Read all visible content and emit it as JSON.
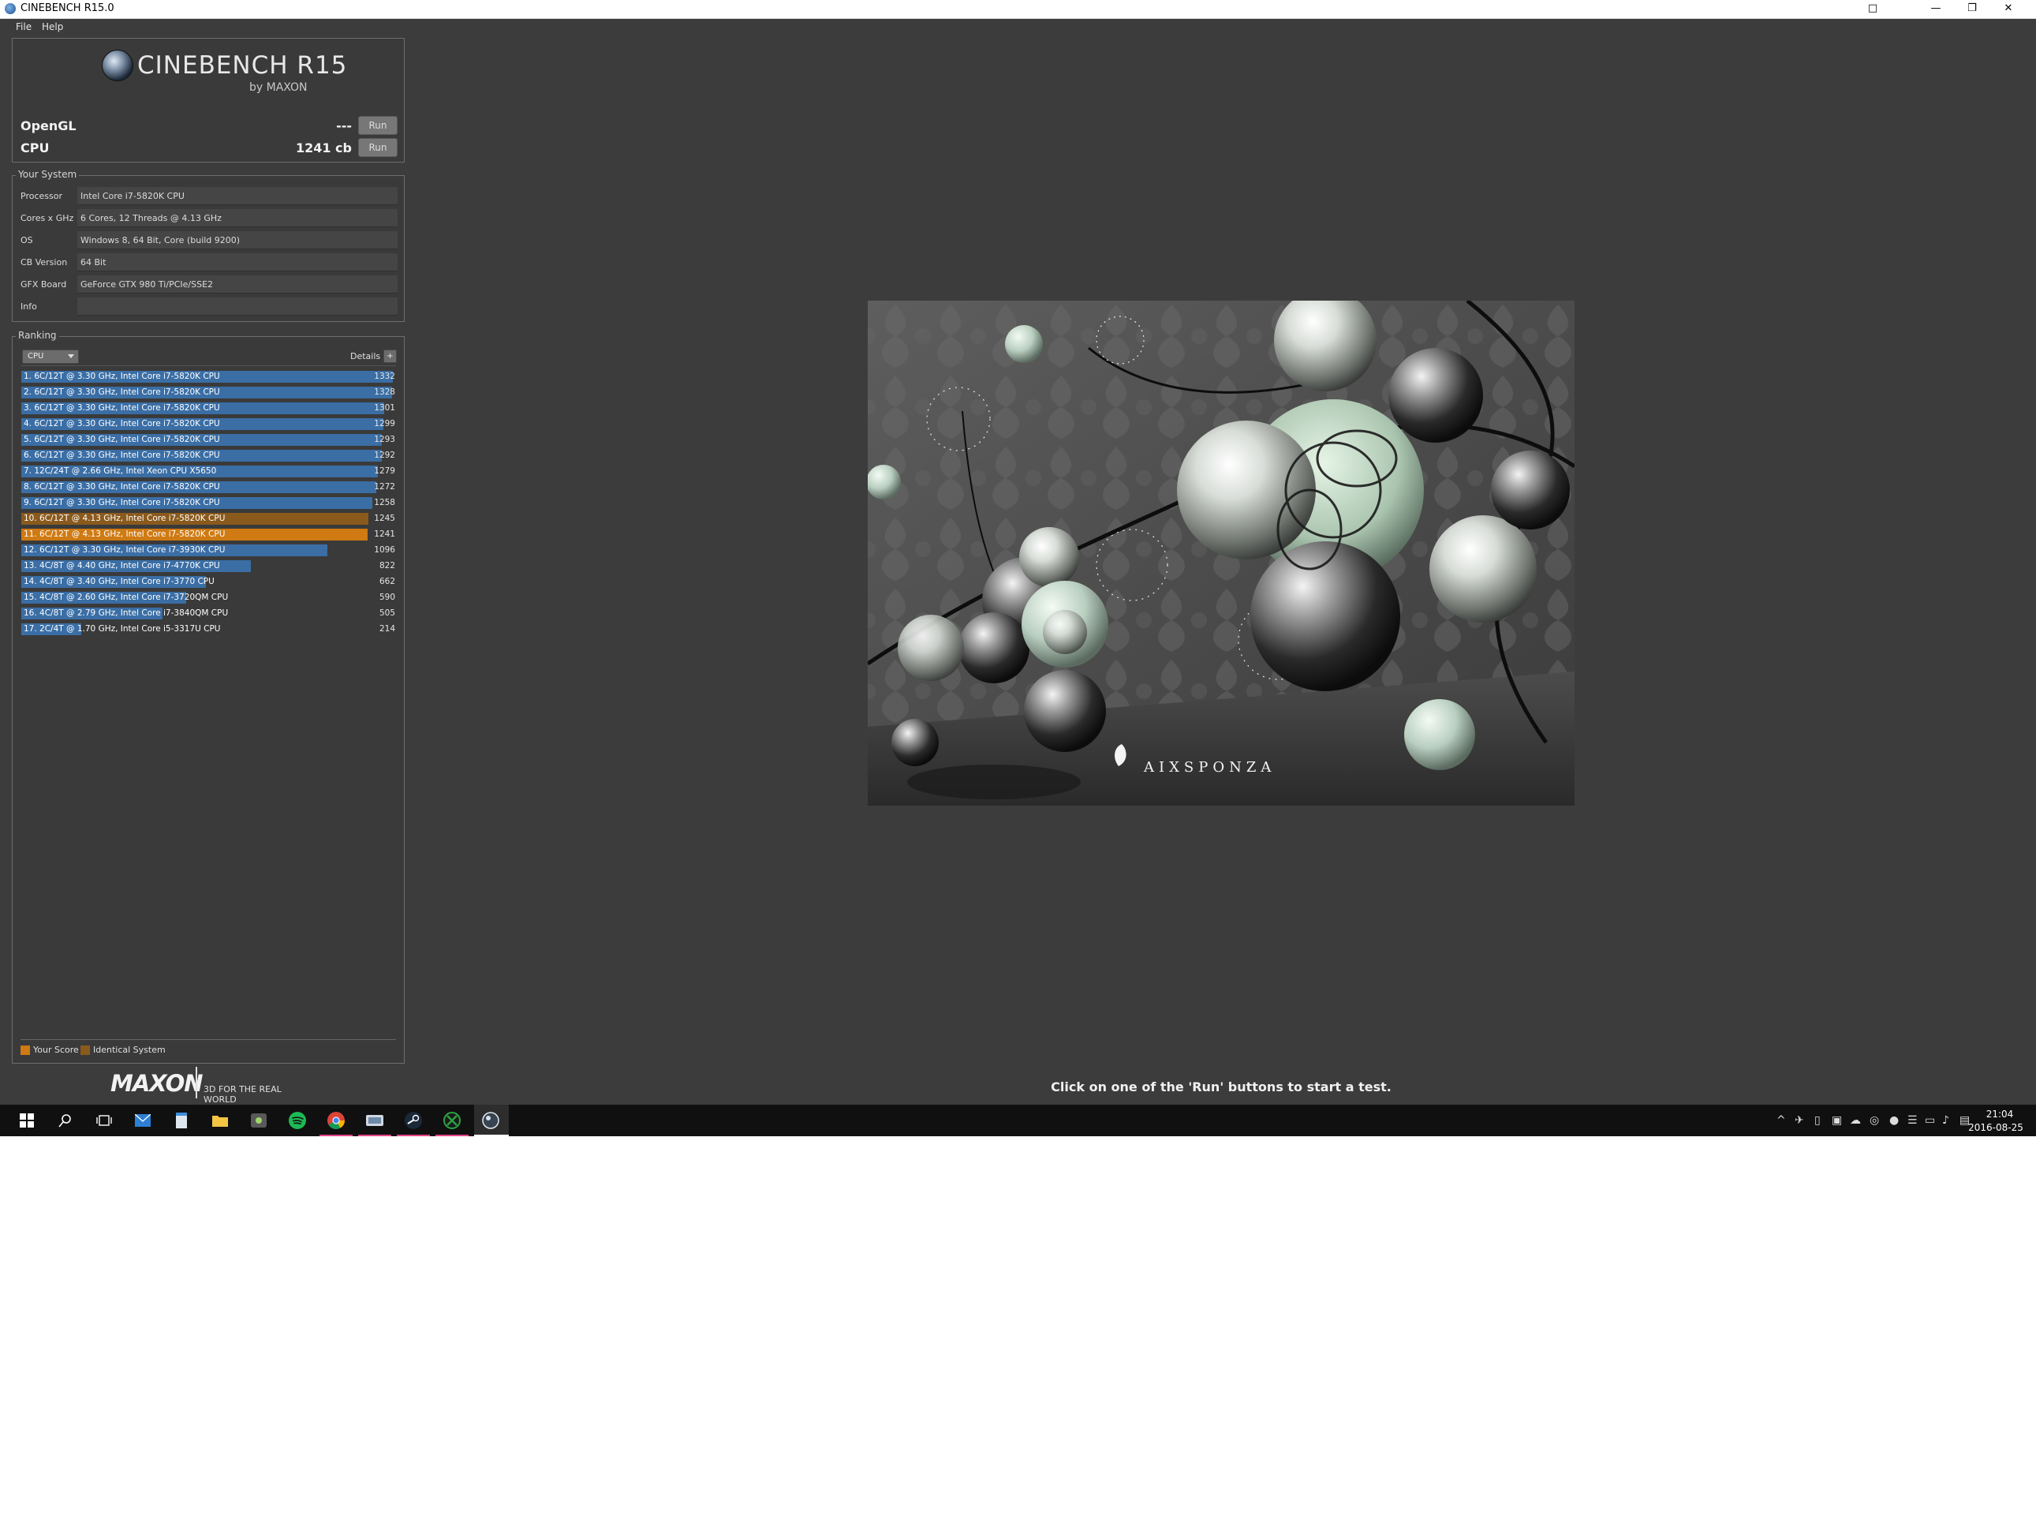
{
  "window": {
    "title": "CINEBENCH R15.0",
    "ctl_max": "□",
    "ctl_close": "✕",
    "ctl_min": "—",
    "ctl_restore": "❐"
  },
  "menu": {
    "file": "File",
    "help": "Help"
  },
  "logo": {
    "main": "CINEBENCH R15",
    "sub": "by MAXON"
  },
  "tests": {
    "opengl": {
      "label": "OpenGL",
      "score": "---",
      "run": "Run"
    },
    "cpu": {
      "label": "CPU",
      "score": "1241 cb",
      "run": "Run"
    }
  },
  "system": {
    "heading": "Your System",
    "rows": [
      {
        "key": "Processor",
        "value": "Intel Core i7-5820K CPU"
      },
      {
        "key": "Cores x GHz",
        "value": "6 Cores, 12 Threads @ 4.13 GHz"
      },
      {
        "key": "OS",
        "value": "Windows 8, 64 Bit, Core (build 9200)"
      },
      {
        "key": "CB Version",
        "value": "64 Bit"
      },
      {
        "key": "GFX Board",
        "value": "GeForce GTX 980 Ti/PCIe/SSE2"
      },
      {
        "key": "Info",
        "value": ""
      }
    ]
  },
  "ranking": {
    "heading": "Ranking",
    "select": "CPU",
    "details": "Details",
    "details_btn": "+",
    "max_score": 1332,
    "colors": {
      "normal": "#3a6ea5",
      "your_score": "#cf7a12",
      "identical": "#8a5a1c"
    },
    "rows": [
      {
        "label": "1. 6C/12T @ 3.30 GHz, Intel Core i7-5820K CPU",
        "score": 1332,
        "kind": "normal"
      },
      {
        "label": "2. 6C/12T @ 3.30 GHz, Intel Core i7-5820K CPU",
        "score": 1328,
        "kind": "normal"
      },
      {
        "label": "3. 6C/12T @ 3.30 GHz, Intel Core i7-5820K CPU",
        "score": 1301,
        "kind": "normal"
      },
      {
        "label": "4. 6C/12T @ 3.30 GHz, Intel Core i7-5820K CPU",
        "score": 1299,
        "kind": "normal"
      },
      {
        "label": "5. 6C/12T @ 3.30 GHz, Intel Core i7-5820K CPU",
        "score": 1293,
        "kind": "normal"
      },
      {
        "label": "6. 6C/12T @ 3.30 GHz, Intel Core i7-5820K CPU",
        "score": 1292,
        "kind": "normal"
      },
      {
        "label": "7. 12C/24T @ 2.66 GHz, Intel Xeon CPU X5650",
        "score": 1279,
        "kind": "normal"
      },
      {
        "label": "8. 6C/12T @ 3.30 GHz, Intel Core i7-5820K CPU",
        "score": 1272,
        "kind": "normal"
      },
      {
        "label": "9. 6C/12T @ 3.30 GHz, Intel Core i7-5820K CPU",
        "score": 1258,
        "kind": "normal"
      },
      {
        "label": "10. 6C/12T @ 4.13 GHz, Intel Core i7-5820K CPU",
        "score": 1245,
        "kind": "identical"
      },
      {
        "label": "11. 6C/12T @ 4.13 GHz, Intel Core i7-5820K CPU",
        "score": 1241,
        "kind": "your_score"
      },
      {
        "label": "12. 6C/12T @ 3.30 GHz,  Intel Core i7-3930K CPU",
        "score": 1096,
        "kind": "normal"
      },
      {
        "label": "13. 4C/8T @ 4.40 GHz, Intel Core i7-4770K CPU",
        "score": 822,
        "kind": "normal"
      },
      {
        "label": "14. 4C/8T @ 3.40 GHz,  Intel Core i7-3770 CPU",
        "score": 662,
        "kind": "normal"
      },
      {
        "label": "15. 4C/8T @ 2.60 GHz, Intel Core i7-3720QM CPU",
        "score": 590,
        "kind": "normal"
      },
      {
        "label": "16. 4C/8T @ 2.79 GHz,  Intel Core i7-3840QM CPU",
        "score": 505,
        "kind": "normal"
      },
      {
        "label": "17. 2C/4T @ 1.70 GHz,  Intel Core i5-3317U CPU",
        "score": 214,
        "kind": "normal"
      }
    ],
    "legend": {
      "your_score": "Your Score",
      "identical": "Identical System"
    }
  },
  "maxon": {
    "word": "MAXON",
    "tagline": "3D FOR THE REAL WORLD"
  },
  "render": {
    "watermark": "AIXSPONZA"
  },
  "status": "Click on one of the 'Run' buttons to start a test.",
  "taskbar": {
    "time": "21:04",
    "date": "2016-08-25",
    "apps": [
      "windows-start",
      "search",
      "task-view",
      "mail",
      "notepad",
      "file-explorer",
      "media",
      "spotify",
      "chrome",
      "remote",
      "steam",
      "xbox",
      "cinebench"
    ]
  }
}
